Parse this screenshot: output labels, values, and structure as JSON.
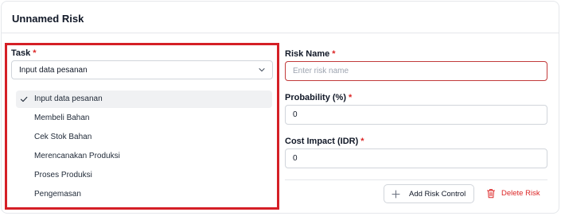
{
  "card": {
    "title": "Unnamed Risk"
  },
  "task": {
    "label": "Task",
    "required_mark": "*",
    "selected_value": "Input data pesanan",
    "options": [
      {
        "label": "Input data pesanan",
        "selected": true
      },
      {
        "label": "Membeli Bahan",
        "selected": false
      },
      {
        "label": "Cek Stok Bahan",
        "selected": false
      },
      {
        "label": "Merencanakan Produksi",
        "selected": false
      },
      {
        "label": "Proses Produksi",
        "selected": false
      },
      {
        "label": "Pengemasan",
        "selected": false
      }
    ]
  },
  "risk_name": {
    "label": "Risk Name",
    "required_mark": "*",
    "value": "",
    "placeholder": "Enter risk name"
  },
  "probability": {
    "label": "Probability (%)",
    "required_mark": "*",
    "value": "0"
  },
  "cost_impact": {
    "label": "Cost Impact (IDR)",
    "required_mark": "*",
    "value": "0"
  },
  "actions": {
    "add_control": "Add Risk Control",
    "delete": "Delete Risk"
  },
  "colors": {
    "required": "#dc2626",
    "highlight": "#d51f26",
    "error_border": "#c23a3a",
    "selected_option_bg": "#f0f1f3"
  },
  "icons": {
    "chevron": "chevron-down-icon",
    "check": "check-icon",
    "plus": "plus-icon",
    "trash": "trash-icon"
  }
}
